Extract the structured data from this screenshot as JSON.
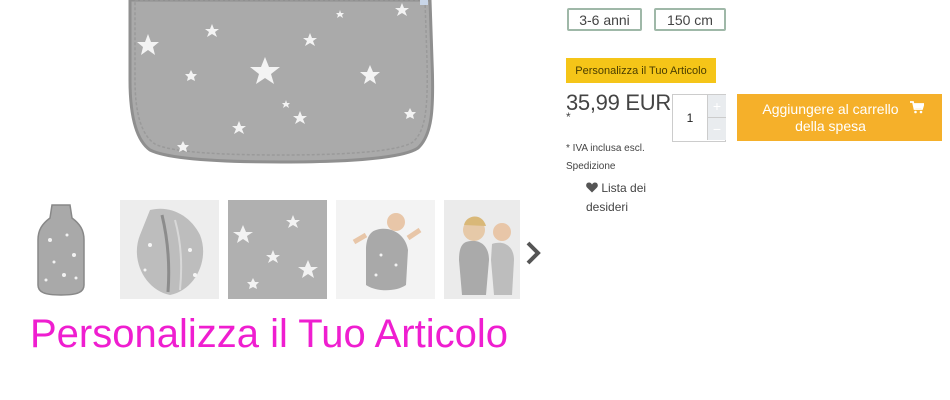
{
  "product": {
    "image_alt": "sleeping-bag-stars-grey",
    "size_options": [
      "3-6 anni",
      "150 cm"
    ],
    "personalize_label": "Personalizza il Tuo Articolo",
    "price": "35,99 EUR",
    "price_footnote_mark": "*",
    "quantity": "1",
    "qty_increment_icon": "+",
    "qty_decrement_icon": "−",
    "add_to_cart_label": "Aggiungere al carrello della spesa",
    "cart_icon": "cart-icon",
    "vat_note": "* IVA inclusa escl.",
    "shipping_note": "Spedizione",
    "wishlist_label": "Lista dei desideri",
    "wishlist_icon": "heart-icon"
  },
  "thumbnails": [
    "thumb-full-sleeping-bag",
    "thumb-zipper-detail",
    "thumb-fabric-stars",
    "thumb-baby-lying",
    "thumb-two-children"
  ],
  "headline": "Personalizza il Tuo Articolo",
  "colors": {
    "accent_yellow": "#f5c518",
    "cart_orange": "#f5b02a",
    "headline_pink": "#ef1ed0",
    "product_grey": "#a9a9a9"
  }
}
